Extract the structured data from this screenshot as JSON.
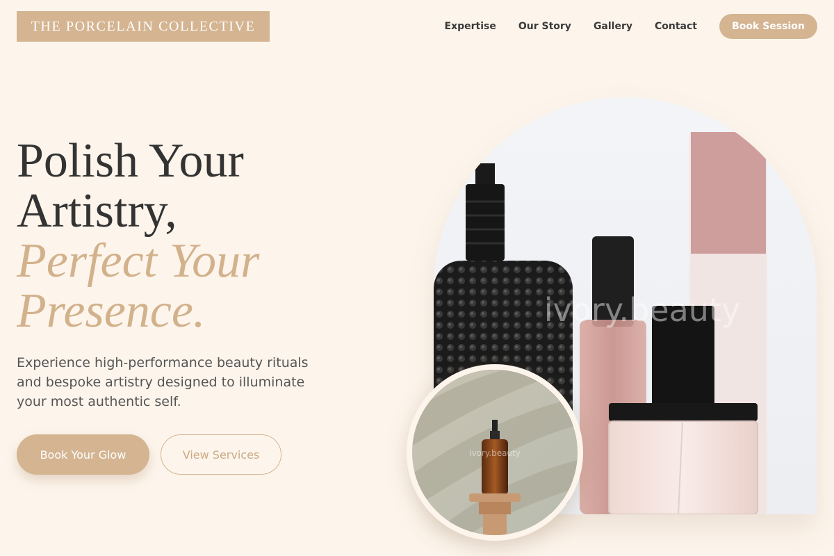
{
  "brand": {
    "name": "THE PORCELAIN COLLECTIVE"
  },
  "nav": {
    "items": [
      "Expertise",
      "Our Story",
      "Gallery",
      "Contact"
    ],
    "cta": "Book Session"
  },
  "hero": {
    "line1": "Polish Your",
    "line2": "Artistry,",
    "line3": "Perfect Your",
    "line4": "Presence.",
    "subtitle": "Experience high-performance beauty rituals and bespoke artistry designed to illuminate your most authentic self.",
    "primary_cta": "Book Your Glow",
    "secondary_cta": "View Services"
  },
  "images": {
    "main_watermark": "ivory.beauty",
    "small_watermark": "ivory.beauty"
  },
  "colors": {
    "background": "#fdf5ec",
    "accent": "#d4b491",
    "heading": "#333333",
    "body_text": "#555555"
  }
}
